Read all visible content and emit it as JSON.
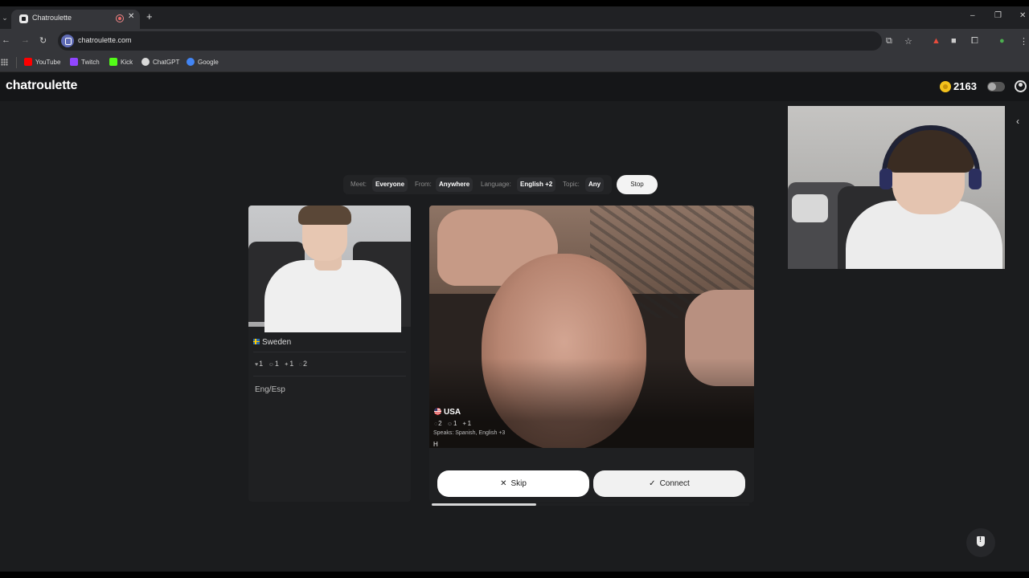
{
  "browser": {
    "tab_title": "Chatroulette",
    "url": "chatroulette.com",
    "bookmarks": [
      {
        "label": "YouTube",
        "color": "#ff0000"
      },
      {
        "label": "Twitch",
        "color": "#9146ff"
      },
      {
        "label": "Kick",
        "color": "#53fc18"
      },
      {
        "label": "ChatGPT",
        "color": "#d9d9d9"
      },
      {
        "label": "Google",
        "color": "#4285f4"
      }
    ]
  },
  "header": {
    "logo": "chatroulette",
    "coins": "2163"
  },
  "filters": {
    "meet_label": "Meet:",
    "meet_value": "Everyone",
    "from_label": "From:",
    "from_value": "Anywhere",
    "language_label": "Language:",
    "language_value": "English +2",
    "topic_label": "Topic:",
    "topic_value": "Any",
    "stop_label": "Stop"
  },
  "self_profile": {
    "country": "Sweden",
    "stats": [
      "1",
      "1",
      "1",
      "2"
    ],
    "bio": "Eng/Esp"
  },
  "partner": {
    "country": "USA",
    "stats": [
      "2",
      "1",
      "1"
    ],
    "speaks": "Speaks: Spanish, English +3",
    "message": "H"
  },
  "actions": {
    "skip_label": "Skip",
    "connect_label": "Connect"
  },
  "progress": {
    "fraction": 0.33
  }
}
